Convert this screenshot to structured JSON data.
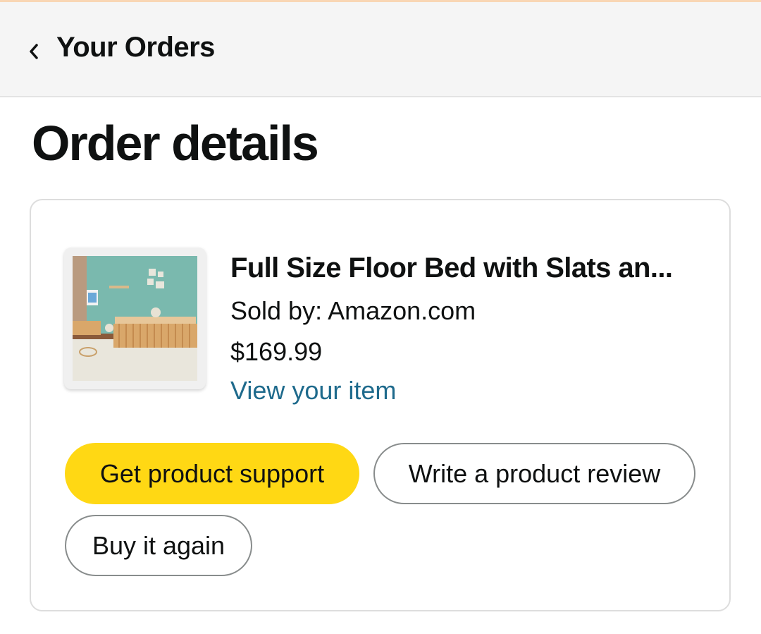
{
  "header": {
    "back_icon": "chevron-left-icon",
    "title": "Your Orders"
  },
  "page": {
    "title": "Order details"
  },
  "order_item": {
    "title": "Full Size Floor Bed with Slats an...",
    "sold_by": "Sold by: Amazon.com",
    "price": "$169.99",
    "view_item_label": "View your item"
  },
  "actions": {
    "support_label": "Get product support",
    "review_label": "Write a product review",
    "buy_again_label": "Buy it again"
  },
  "colors": {
    "header_bg": "#f5f5f5",
    "primary_button": "#ffd814",
    "link": "#1e6a8c",
    "text": "#0f1111"
  }
}
